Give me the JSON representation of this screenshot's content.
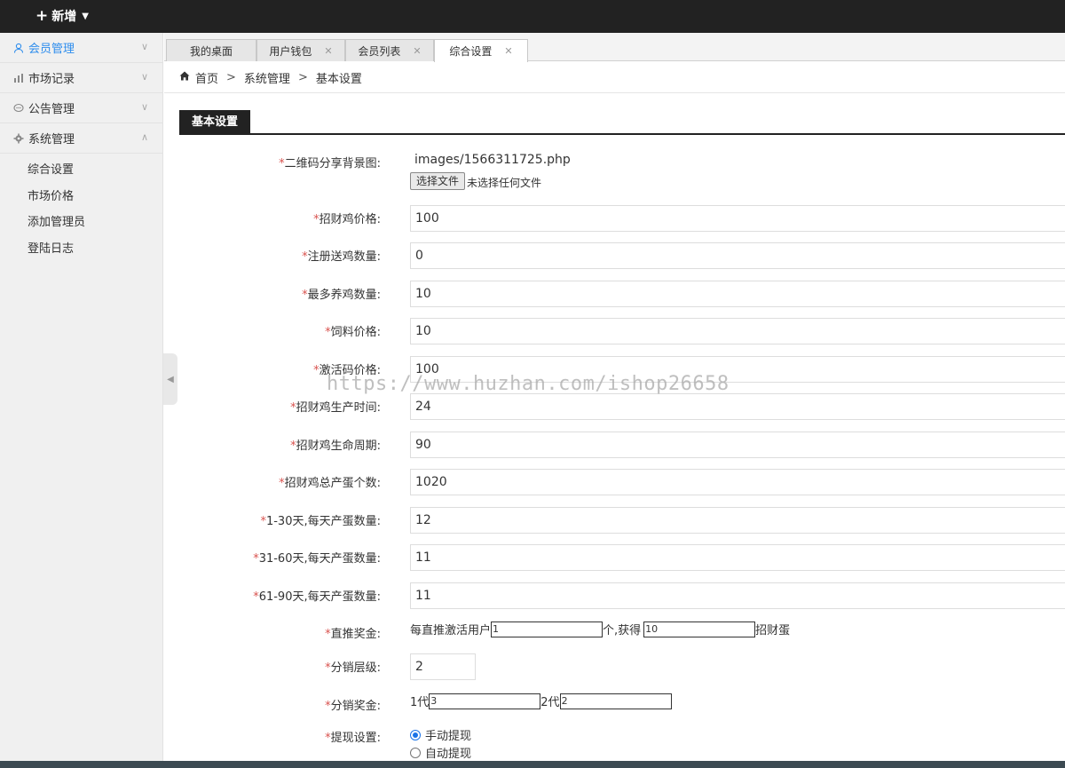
{
  "topbar": {
    "add_label": "新增"
  },
  "sidebar": {
    "items": [
      {
        "label": "会员管理",
        "icon": "user-icon",
        "arrow": "∨",
        "active": true
      },
      {
        "label": "市场记录",
        "icon": "chart-icon",
        "arrow": "∨"
      },
      {
        "label": "公告管理",
        "icon": "message-icon",
        "arrow": "∨"
      },
      {
        "label": "系统管理",
        "icon": "gear-icon",
        "arrow": "∧"
      }
    ],
    "subitems": [
      "综合设置",
      "市场价格",
      "添加管理员",
      "登陆日志"
    ]
  },
  "tabs": [
    {
      "label": "我的桌面"
    },
    {
      "label": "用户钱包"
    },
    {
      "label": "会员列表"
    },
    {
      "label": "综合设置"
    }
  ],
  "breadcrumb": {
    "home": "首页",
    "level1": "系统管理",
    "level2": "基本设置",
    "sep": ">"
  },
  "section": {
    "title": "基本设置"
  },
  "form": {
    "qr_bg": {
      "label": "二维码分享背景图:",
      "value": "images/1566311725.php",
      "button": "选择文件",
      "status": "未选择任何文件"
    },
    "chicken_price": {
      "label": "招财鸡价格:",
      "value": "100"
    },
    "register_gift": {
      "label": "注册送鸡数量:",
      "value": "0"
    },
    "max_chickens": {
      "label": "最多养鸡数量:",
      "value": "10"
    },
    "feed_price": {
      "label": "饲料价格:",
      "value": "10"
    },
    "activation_price": {
      "label": "激活码价格:",
      "value": "100"
    },
    "production_time": {
      "label": "招财鸡生产时间:",
      "value": "24"
    },
    "life_cycle": {
      "label": "招财鸡生命周期:",
      "value": "90"
    },
    "total_eggs": {
      "label": "招财鸡总产蛋个数:",
      "value": "1020"
    },
    "eggs_1_30": {
      "label": "1-30天,每天产蛋数量:",
      "value": "12"
    },
    "eggs_31_60": {
      "label": "31-60天,每天产蛋数量:",
      "value": "11"
    },
    "eggs_61_90": {
      "label": "61-90天,每天产蛋数量:",
      "value": "11"
    },
    "direct_bonus": {
      "label": "直推奖金:",
      "prefix": "每直推激活用户",
      "users": "1",
      "middle": "个,获得",
      "eggs": "10",
      "suffix": "招财蛋"
    },
    "dist_levels": {
      "label": "分销层级:",
      "value": "2"
    },
    "dist_bonus": {
      "label": "分销奖金:",
      "gen1_label": "1代",
      "gen1": "3",
      "gen2_label": "2代",
      "gen2": "2"
    },
    "withdraw": {
      "label": "提现设置:",
      "manual": "手动提现",
      "auto": "自动提现"
    }
  },
  "watermark": "https://www.huzhan.com/ishop26658",
  "colors": {
    "accent": "#2e8ded",
    "required": "#d9534f",
    "topbar": "#222222"
  }
}
